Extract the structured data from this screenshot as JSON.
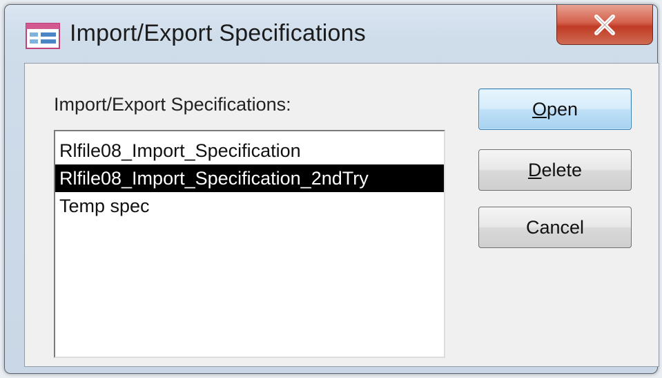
{
  "window": {
    "title": "Import/Export Specifications"
  },
  "icons": {
    "app": "table-window-icon",
    "close": "close-x-icon"
  },
  "colors": {
    "close_button": "#c9452f",
    "default_button": "#bfe0f7",
    "selection": "#000000"
  },
  "list": {
    "label": "Import/Export Specifications:",
    "items": [
      "Rlfile08_Import_Specification",
      "Rlfile08_Import_Specification_2ndTry",
      "Temp spec"
    ],
    "selected_index": 1
  },
  "buttons": {
    "open": {
      "accel": "O",
      "rest": "pen"
    },
    "delete": {
      "accel": "D",
      "rest": "elete"
    },
    "cancel": {
      "label": "Cancel"
    }
  }
}
